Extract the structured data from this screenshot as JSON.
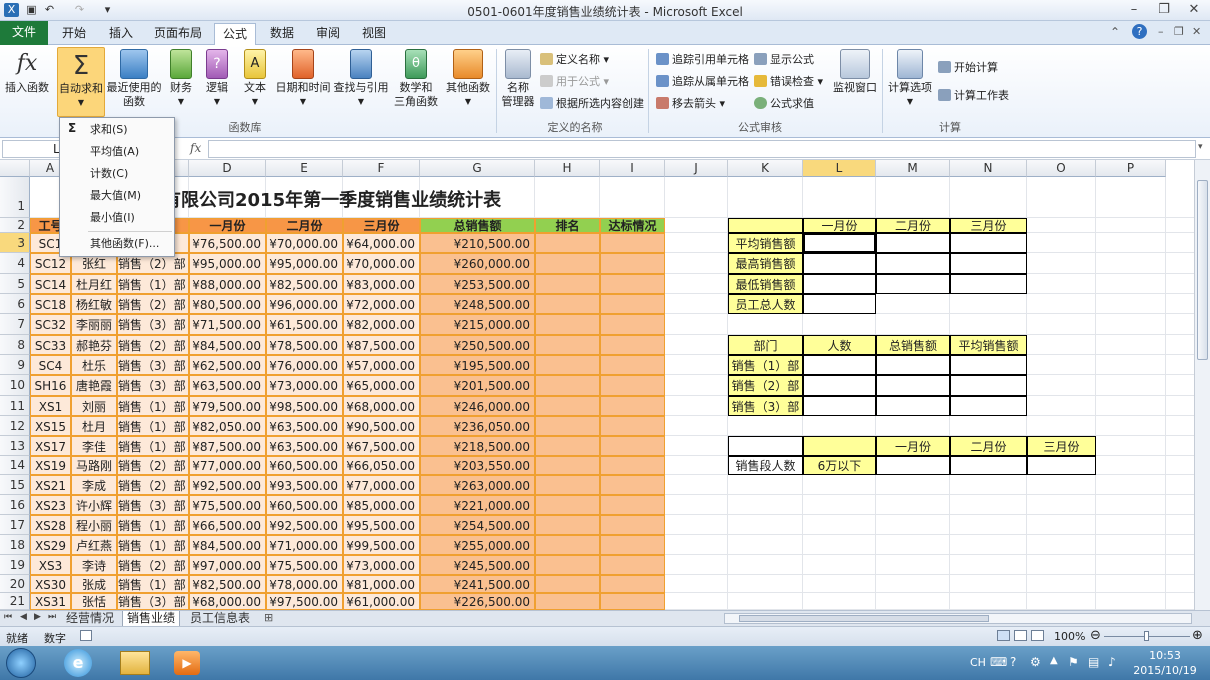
{
  "window": {
    "title": "0501-0601年度销售业绩统计表 - Microsoft Excel"
  },
  "tabs": [
    "文件",
    "开始",
    "插入",
    "页面布局",
    "公式",
    "数据",
    "审阅",
    "视图"
  ],
  "ribbon": {
    "insert_function": "插入函数",
    "autosum": "自动求和",
    "recent": [
      "最近使用的",
      "函数"
    ],
    "finance": "财务",
    "logic": "逻辑",
    "text": "文本",
    "datetime": "日期和时间",
    "lookup": "查找与引用",
    "math": [
      "数学和",
      "三角函数"
    ],
    "other": "其他函数",
    "name_mgr": [
      "名称",
      "管理器"
    ],
    "define_name": "定义名称",
    "use_in_formula": "用于公式",
    "create_from_sel": "根据所选内容创建",
    "trace_prec": "追踪引用单元格",
    "trace_dep": "追踪从属单元格",
    "remove_arrows": "移去箭头",
    "show_formulas": "显示公式",
    "error_check": "错误检查",
    "eval_formula": "公式求值",
    "watch": "监视窗口",
    "calc_options": "计算选项",
    "calc_now": "开始计算",
    "calc_sheet": "计算工作表",
    "groups": {
      "lib": "函数库",
      "names": "定义的名称",
      "audit": "公式审核",
      "calc": "计算"
    }
  },
  "formula_bar": {
    "namebox": "L",
    "fx": "fx"
  },
  "menu": {
    "items": [
      "求和(S)",
      "平均值(A)",
      "计数(C)",
      "最大值(M)",
      "最小值(I)",
      "其他函数(F)..."
    ],
    "sigma": "Σ"
  },
  "columns": [
    "A",
    "B",
    "C",
    "D",
    "E",
    "F",
    "G",
    "H",
    "I",
    "J",
    "K",
    "L",
    "M",
    "N",
    "O",
    "P"
  ],
  "rows": [
    "1",
    "2",
    "3",
    "4",
    "5",
    "6",
    "7",
    "8",
    "9",
    "10",
    "11",
    "12",
    "13",
    "14",
    "15",
    "16",
    "17",
    "18",
    "19",
    "20",
    "21"
  ],
  "sheet": {
    "title": "有限公司2015年第一季度销售业绩统计表",
    "headers": [
      "工号",
      "一月份",
      "二月份",
      "三月份",
      "总销售额",
      "排名",
      "达标情况"
    ],
    "data": [
      [
        "SC1",
        "",
        "部",
        "¥76,500.00",
        "¥70,000.00",
        "¥64,000.00",
        "¥210,500.00"
      ],
      [
        "SC12",
        "张红",
        "销售（2）部",
        "¥95,000.00",
        "¥95,000.00",
        "¥70,000.00",
        "¥260,000.00"
      ],
      [
        "SC14",
        "杜月红",
        "销售（1）部",
        "¥88,000.00",
        "¥82,500.00",
        "¥83,000.00",
        "¥253,500.00"
      ],
      [
        "SC18",
        "杨红敏",
        "销售（2）部",
        "¥80,500.00",
        "¥96,000.00",
        "¥72,000.00",
        "¥248,500.00"
      ],
      [
        "SC32",
        "李丽丽",
        "销售（3）部",
        "¥71,500.00",
        "¥61,500.00",
        "¥82,000.00",
        "¥215,000.00"
      ],
      [
        "SC33",
        "郝艳芬",
        "销售（2）部",
        "¥84,500.00",
        "¥78,500.00",
        "¥87,500.00",
        "¥250,500.00"
      ],
      [
        "SC4",
        "杜乐",
        "销售（3）部",
        "¥62,500.00",
        "¥76,000.00",
        "¥57,000.00",
        "¥195,500.00"
      ],
      [
        "SH16",
        "唐艳霞",
        "销售（3）部",
        "¥63,500.00",
        "¥73,000.00",
        "¥65,000.00",
        "¥201,500.00"
      ],
      [
        "XS1",
        "刘丽",
        "销售（1）部",
        "¥79,500.00",
        "¥98,500.00",
        "¥68,000.00",
        "¥246,000.00"
      ],
      [
        "XS15",
        "杜月",
        "销售（1）部",
        "¥82,050.00",
        "¥63,500.00",
        "¥90,500.00",
        "¥236,050.00"
      ],
      [
        "XS17",
        "李佳",
        "销售（1）部",
        "¥87,500.00",
        "¥63,500.00",
        "¥67,500.00",
        "¥218,500.00"
      ],
      [
        "XS19",
        "马路刚",
        "销售（2）部",
        "¥77,000.00",
        "¥60,500.00",
        "¥66,050.00",
        "¥203,550.00"
      ],
      [
        "XS21",
        "李成",
        "销售（2）部",
        "¥92,500.00",
        "¥93,500.00",
        "¥77,000.00",
        "¥263,000.00"
      ],
      [
        "XS23",
        "许小辉",
        "销售（3）部",
        "¥75,500.00",
        "¥60,500.00",
        "¥85,000.00",
        "¥221,000.00"
      ],
      [
        "XS28",
        "程小丽",
        "销售（1）部",
        "¥66,500.00",
        "¥92,500.00",
        "¥95,500.00",
        "¥254,500.00"
      ],
      [
        "XS29",
        "卢红燕",
        "销售（1）部",
        "¥84,500.00",
        "¥71,000.00",
        "¥99,500.00",
        "¥255,000.00"
      ],
      [
        "XS3",
        "李诗",
        "销售（2）部",
        "¥97,000.00",
        "¥75,500.00",
        "¥73,000.00",
        "¥245,500.00"
      ],
      [
        "XS30",
        "张成",
        "销售（1）部",
        "¥82,500.00",
        "¥78,000.00",
        "¥81,000.00",
        "¥241,500.00"
      ],
      [
        "XS31",
        "张恬",
        "销售（3）部",
        "¥68,000.00",
        "¥97,500.00",
        "¥61,000.00",
        "¥226,500.00"
      ]
    ],
    "stats": {
      "months": [
        "一月份",
        "二月份",
        "三月份"
      ],
      "labels": [
        "平均销售额",
        "最高销售额",
        "最低销售额"
      ],
      "total_staff": "员工总人数"
    },
    "dept": {
      "headers": [
        "部门",
        "人数",
        "总销售额",
        "平均销售额"
      ],
      "rows": [
        "销售（1）部",
        "销售（2）部",
        "销售（3）部"
      ]
    },
    "band": {
      "months": [
        "一月份",
        "二月份",
        "三月份"
      ],
      "label": "销售段人数",
      "value": "6万以下"
    }
  },
  "sheet_tabs": [
    "经营情况",
    "销售业绩",
    "员工信息表"
  ],
  "status": {
    "ready": "就绪",
    "num": "数字",
    "zoom": "100%"
  },
  "taskbar": {
    "lang": "CH",
    "time": "10:53",
    "date": "2015/10/19"
  }
}
